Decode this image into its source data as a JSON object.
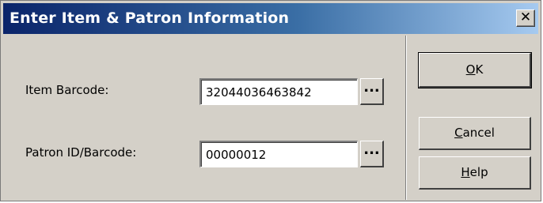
{
  "window": {
    "title": "Enter Item & Patron Information",
    "close_glyph": "✕"
  },
  "form": {
    "item_barcode": {
      "label": "Item Barcode:",
      "value": "32044036463842",
      "browse_label": "..."
    },
    "patron_barcode": {
      "label": "Patron ID/Barcode:",
      "value": "00000012",
      "browse_label": "..."
    }
  },
  "buttons": {
    "ok": {
      "mnemonic": "O",
      "rest": "K"
    },
    "cancel": {
      "mnemonic": "C",
      "rest": "ancel"
    },
    "help": {
      "mnemonic": "H",
      "rest": "elp"
    }
  },
  "icons": {
    "close": "close-icon",
    "browse": "ellipsis-icon"
  },
  "colors": {
    "titlebar_start": "#0a246a",
    "titlebar_end": "#a6caf0",
    "dialog_face": "#d4d0c8"
  }
}
